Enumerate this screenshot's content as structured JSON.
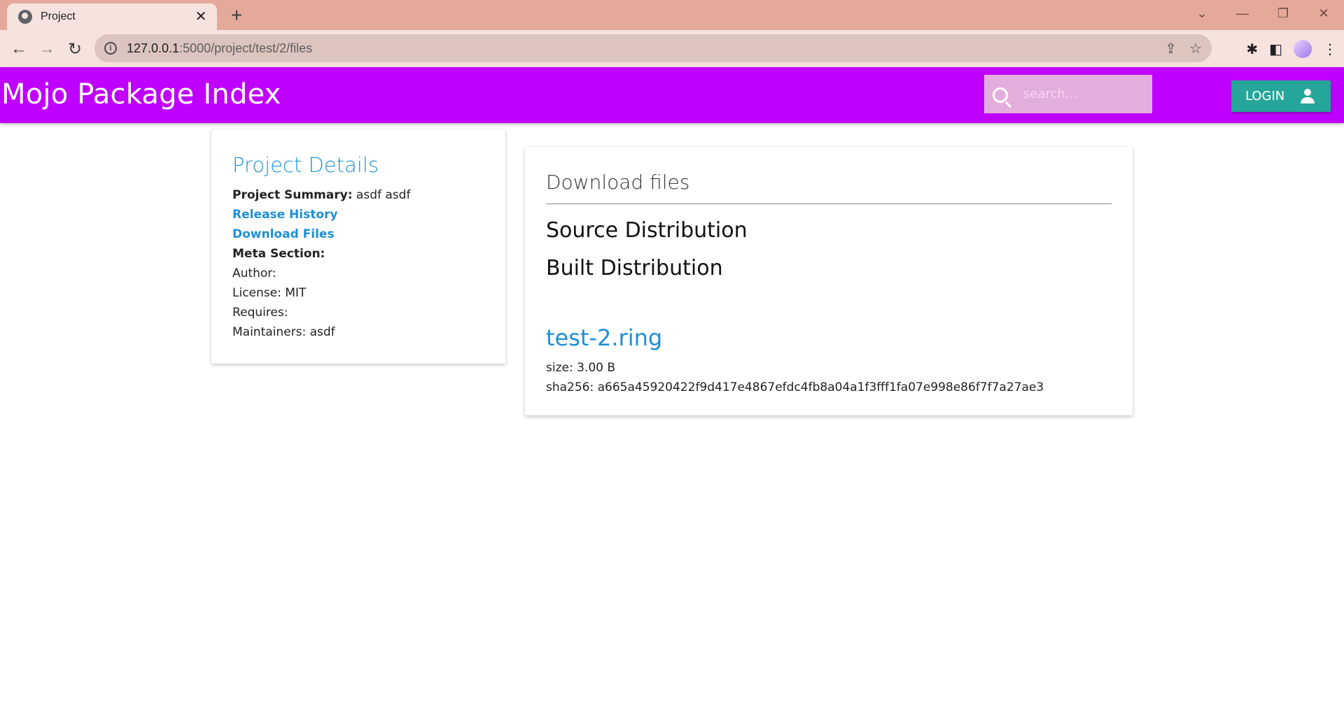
{
  "browser": {
    "tab_title": "Project",
    "tab_close": "✕",
    "new_tab": "+",
    "url_host": "127.0.0.1",
    "url_path": ":5000/project/test/2/files",
    "window_controls": [
      "⌄",
      "—",
      "❐",
      "✕"
    ]
  },
  "header": {
    "brand": "Mojo Package Index",
    "search_placeholder": "search...",
    "login_label": "LOGIN"
  },
  "details": {
    "title": "Project Details",
    "summary_label": "Project Summary:",
    "summary_value": "asdf asdf",
    "release_history_link": "Release History",
    "download_files_link": "Download Files",
    "meta_label": "Meta Section:",
    "author": "Author:",
    "license": "License: MIT",
    "requires": "Requires:",
    "maintainers": "Maintainers: asdf"
  },
  "files": {
    "title": "Download files",
    "source_heading": "Source Distribution",
    "built_heading": "Built Distribution",
    "file_name": "test-2.ring",
    "file_size": "size: 3.00 B",
    "file_sha": "sha256: a665a45920422f9d417e4867efdc4fb8a04a1f3fff1fa07e998e86f7f7a27ae3"
  },
  "colors": {
    "appbar": "#c000ff",
    "login_button": "#26a69a",
    "link": "#1e8fd6"
  }
}
